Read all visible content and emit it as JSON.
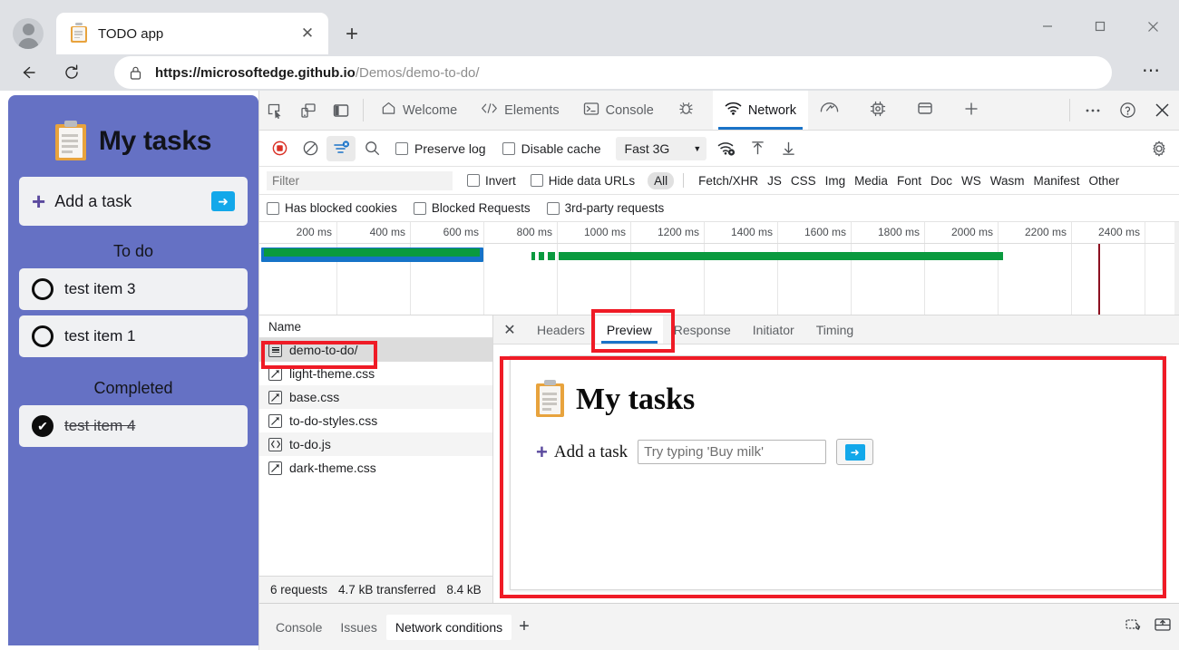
{
  "browser": {
    "tab": {
      "title": "TODO app",
      "favicon": "clipboard-icon",
      "close": "✕"
    },
    "new_tab": "+",
    "window_controls": {
      "minimize": "—",
      "maximize": "□",
      "close": "✕"
    },
    "url_secure_part": "https://microsoftedge.github.io",
    "url_rest": "/Demos/demo-to-do/",
    "settings_dots": "⋯"
  },
  "todo_app": {
    "title": "My tasks",
    "add_task_label": "Add a task",
    "add_task_plus": "+",
    "go_arrow": "➜",
    "sections": [
      {
        "title": "To do",
        "items": [
          {
            "label": "test item 3",
            "done": false
          },
          {
            "label": "test item 1",
            "done": false
          }
        ]
      },
      {
        "title": "Completed",
        "items": [
          {
            "label": "test item 4",
            "done": true
          }
        ]
      }
    ],
    "check_glyph": "✔"
  },
  "devtools": {
    "left_icons": [
      "inspect-icon",
      "device-emulation-icon",
      "dock-side-icon"
    ],
    "panels": [
      {
        "label": "Welcome",
        "icon": "home-icon",
        "active": false
      },
      {
        "label": "Elements",
        "icon": "code-brackets-icon",
        "active": false
      },
      {
        "label": "Console",
        "icon": "console-terminal-icon",
        "active": false
      },
      {
        "label": "",
        "icon": "bug-sources-icon",
        "active": false
      },
      {
        "label": "Network",
        "icon": "network-wifi-icon",
        "active": true
      },
      {
        "label": "",
        "icon": "performance-gauge-icon",
        "active": false
      },
      {
        "label": "",
        "icon": "application-chip-icon",
        "active": false
      },
      {
        "label": "",
        "icon": "memory-panel-icon",
        "active": false
      },
      {
        "label": "",
        "icon": "add-panel-plus-icon",
        "active": false
      }
    ],
    "tabbar_right": [
      "more-tools-dots-icon",
      "help-question-icon",
      "close-devtools-icon"
    ],
    "toolbar": {
      "record_icon": "record-stop-icon",
      "clear_icon": "clear-network-icon",
      "filter_icon": "filter-funnel-icon",
      "search_icon": "search-icon",
      "preserve_log": "Preserve log",
      "disable_cache": "Disable cache",
      "throttling_value": "Fast 3G",
      "throttling_caret": "▼",
      "network_conditions_icon": "network-conditions-icon",
      "import_har_icon": "import-har-icon",
      "export_har_icon": "export-har-icon",
      "settings_icon": "gear-icon"
    },
    "filterbar": {
      "placeholder": "Filter",
      "invert": "Invert",
      "hide_data_urls": "Hide data URLs",
      "types": [
        "All",
        "Fetch/XHR",
        "JS",
        "CSS",
        "Img",
        "Media",
        "Font",
        "Doc",
        "WS",
        "Wasm",
        "Manifest",
        "Other"
      ],
      "selected_type": "All"
    },
    "filterbar2": {
      "has_blocked_cookies": "Has blocked cookies",
      "blocked_requests": "Blocked Requests",
      "third_party_requests": "3rd-party requests"
    },
    "overview": {
      "tick_labels": [
        "200 ms",
        "400 ms",
        "600 ms",
        "800 ms",
        "1000 ms",
        "1200 ms",
        "1400 ms",
        "1600 ms",
        "1800 ms",
        "2000 ms",
        "2200 ms",
        "2400 ms"
      ]
    },
    "requests": {
      "column_header": "Name",
      "rows": [
        {
          "name": "demo-to-do/",
          "icon": "document-icon",
          "selected": true
        },
        {
          "name": "light-theme.css",
          "icon": "stylesheet-icon",
          "selected": false
        },
        {
          "name": "base.css",
          "icon": "stylesheet-icon",
          "selected": false
        },
        {
          "name": "to-do-styles.css",
          "icon": "stylesheet-icon",
          "selected": false
        },
        {
          "name": "to-do.js",
          "icon": "script-icon",
          "selected": false
        },
        {
          "name": "dark-theme.css",
          "icon": "stylesheet-icon",
          "selected": false
        }
      ],
      "status_requests": "6 requests",
      "status_transferred": "4.7 kB transferred",
      "status_resources": "8.4 kB"
    },
    "detail": {
      "close_icon": "✕",
      "tabs": [
        "Headers",
        "Preview",
        "Response",
        "Initiator",
        "Timing"
      ],
      "active_tab": "Preview"
    },
    "preview": {
      "title": "My tasks",
      "add_label": "Add a task",
      "plus": "+",
      "input_placeholder": "Try typing 'Buy milk'",
      "go_arrow": "➜"
    },
    "drawer": {
      "tabs": [
        "Console",
        "Issues",
        "Network conditions"
      ],
      "active_tab": "Network conditions",
      "plus": "+",
      "right_icons": [
        "restore-drawer-icon",
        "dock-drawer-icon"
      ]
    }
  },
  "annotations": {
    "highlight_color": "#ef1b26",
    "boxes": [
      "request-row-highlight",
      "preview-tab-highlight",
      "preview-panel-highlight"
    ]
  },
  "colors": {
    "app_purple": "#6571c4",
    "accent_blue": "#1a73c8",
    "go_button_blue": "#13a8ea",
    "plus_purple": "#5b4a9e",
    "timeline_green": "#0a9a3f",
    "timeline_blue": "#1573c8",
    "annotation_red": "#ef1b26"
  }
}
